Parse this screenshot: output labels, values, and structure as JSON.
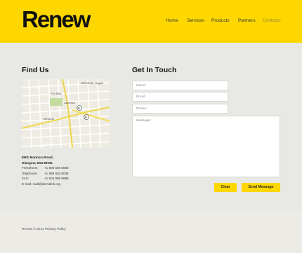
{
  "header": {
    "logo": "Renew",
    "nav": [
      {
        "label": "Home"
      },
      {
        "label": "Services"
      },
      {
        "label": "Products"
      },
      {
        "label": "Partners"
      },
      {
        "label": "Contacts"
      }
    ],
    "active_nav": "Contacts"
  },
  "find_us": {
    "title": "Find Us",
    "map": {
      "labels": [
        "Fox Park",
        "MEMORIAL Heights",
        "Lawrence",
        "Glenwood",
        "80",
        "80"
      ]
    },
    "address": {
      "line1": "8901 Marmora Road,",
      "line2": "Glasgow, D04 89GR.",
      "rows": [
        {
          "k": "Freephone:",
          "v": "+1 800 559 6580"
        },
        {
          "k": "Telephone:",
          "v": "+1 959 603 6035"
        },
        {
          "k": "FAX:",
          "v": "+1 504 889 9898"
        }
      ],
      "email_label": "E-mail:",
      "email": "mail@demolink.org"
    }
  },
  "get_in_touch": {
    "title": "Get In Touch",
    "name_placeholder": "Name:",
    "email_placeholder": "Email:",
    "phone_placeholder": "Phone:",
    "message_placeholder": "Message:",
    "clear_label": "Clear",
    "send_label": "Send Message"
  },
  "footer": {
    "copyright": "Renew © 2011",
    "privacy": "Privacy Policy"
  },
  "colors": {
    "accent": "#fed700",
    "background": "#e8e8e4",
    "footer": "#ecebe6"
  }
}
